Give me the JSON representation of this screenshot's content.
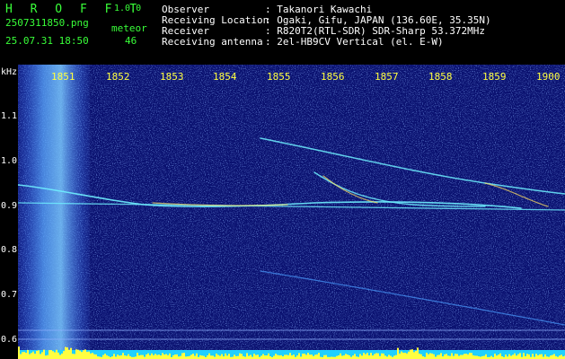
{
  "brand": "H R O F F T",
  "version": "1.0.0",
  "filename": "2507311850.png",
  "datetime": "25.07.31 18:50",
  "meteor_label": "meteor",
  "meteor_count": "46",
  "info": {
    "observer_key": "Observer",
    "observer_val": ": Takanori Kawachi",
    "location_key": "Receiving Location",
    "location_val": ": Ogaki, Gifu, JAPAN (136.60E, 35.35N)",
    "receiver_key": "Receiver",
    "receiver_val": ": R820T2(RTL-SDR) SDR-Sharp 53.372MHz",
    "antenna_key": "Receiving antenna",
    "antenna_val": ": 2el-HB9CV Vertical (el. E-W)"
  },
  "y_axis": {
    "unit": "kHz",
    "ticks": [
      "1.1",
      "1.0",
      "0.9",
      "0.8",
      "0.7",
      "0.6"
    ]
  },
  "x_axis": {
    "ticks": [
      "1851",
      "1852",
      "1853",
      "1854",
      "1855",
      "1856",
      "1857",
      "1858",
      "1859",
      "1900"
    ]
  },
  "colors": {
    "background": "#0a1170",
    "noise": "#2a48d8",
    "band": "#4a9cff",
    "trail": "#6ff0ff",
    "hot": "#ffe060",
    "bar": "#ffff40",
    "baseline": "#20d0ff"
  }
}
